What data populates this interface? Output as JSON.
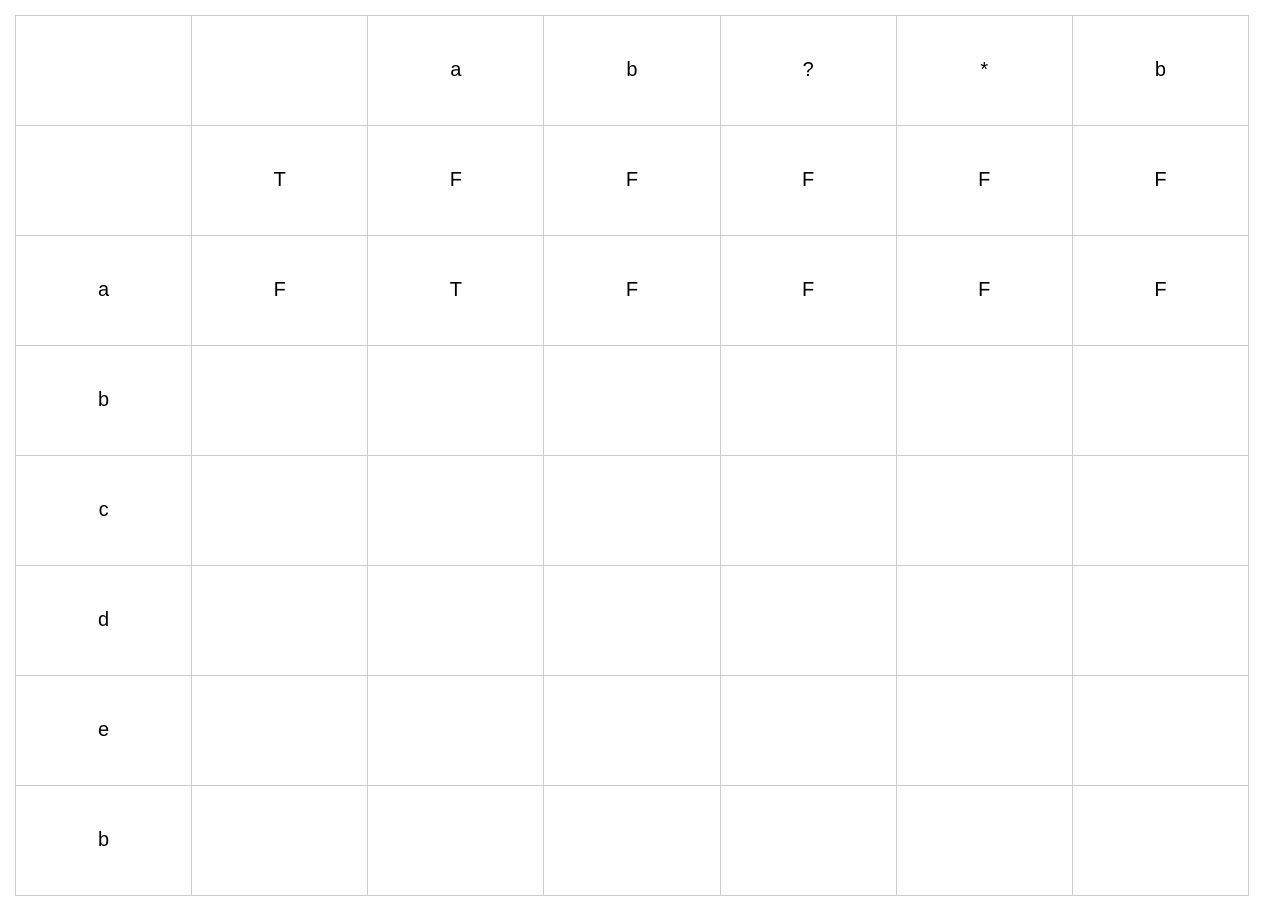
{
  "grid": {
    "columns": 7,
    "rows": 8,
    "cells": [
      [
        {
          "text": "",
          "highlight": false
        },
        {
          "text": "",
          "highlight": false
        },
        {
          "text": "a",
          "highlight": false
        },
        {
          "text": "b",
          "highlight": false
        },
        {
          "text": "?",
          "highlight": false
        },
        {
          "text": "*",
          "highlight": false
        },
        {
          "text": "b",
          "highlight": false
        }
      ],
      [
        {
          "text": "",
          "highlight": false
        },
        {
          "text": "T",
          "highlight": true
        },
        {
          "text": "F",
          "highlight": false
        },
        {
          "text": "F",
          "highlight": false
        },
        {
          "text": "F",
          "highlight": true
        },
        {
          "text": "F",
          "highlight": false
        },
        {
          "text": "F",
          "highlight": false
        }
      ],
      [
        {
          "text": "a",
          "highlight": false
        },
        {
          "text": "F",
          "highlight": false
        },
        {
          "text": "T",
          "highlight": true
        },
        {
          "text": "F",
          "highlight": false
        },
        {
          "text": "F",
          "highlight": false
        },
        {
          "text": "F",
          "highlight": true
        },
        {
          "text": "F",
          "highlight": false
        }
      ],
      [
        {
          "text": "b",
          "highlight": false
        },
        {
          "text": "",
          "highlight": false
        },
        {
          "text": "",
          "highlight": false
        },
        {
          "text": "",
          "highlight": false
        },
        {
          "text": "",
          "highlight": false
        },
        {
          "text": "",
          "highlight": false
        },
        {
          "text": "",
          "highlight": false
        }
      ],
      [
        {
          "text": "c",
          "highlight": false
        },
        {
          "text": "",
          "highlight": false
        },
        {
          "text": "",
          "highlight": false
        },
        {
          "text": "",
          "highlight": false
        },
        {
          "text": "",
          "highlight": false
        },
        {
          "text": "",
          "highlight": false
        },
        {
          "text": "",
          "highlight": false
        }
      ],
      [
        {
          "text": "d",
          "highlight": false
        },
        {
          "text": "",
          "highlight": false
        },
        {
          "text": "",
          "highlight": false
        },
        {
          "text": "",
          "highlight": false
        },
        {
          "text": "",
          "highlight": false
        },
        {
          "text": "",
          "highlight": false
        },
        {
          "text": "",
          "highlight": false
        }
      ],
      [
        {
          "text": "e",
          "highlight": false
        },
        {
          "text": "",
          "highlight": false
        },
        {
          "text": "",
          "highlight": false
        },
        {
          "text": "",
          "highlight": false
        },
        {
          "text": "",
          "highlight": false
        },
        {
          "text": "",
          "highlight": false
        },
        {
          "text": "",
          "highlight": false
        }
      ],
      [
        {
          "text": "b",
          "highlight": false
        },
        {
          "text": "",
          "highlight": false
        },
        {
          "text": "",
          "highlight": false
        },
        {
          "text": "",
          "highlight": false
        },
        {
          "text": "",
          "highlight": false
        },
        {
          "text": "",
          "highlight": false
        },
        {
          "text": "",
          "highlight": false
        }
      ]
    ]
  },
  "colors": {
    "highlight": "#ea4e3d",
    "text": "#000000",
    "border": "#cccccc",
    "background": "#ffffff"
  }
}
